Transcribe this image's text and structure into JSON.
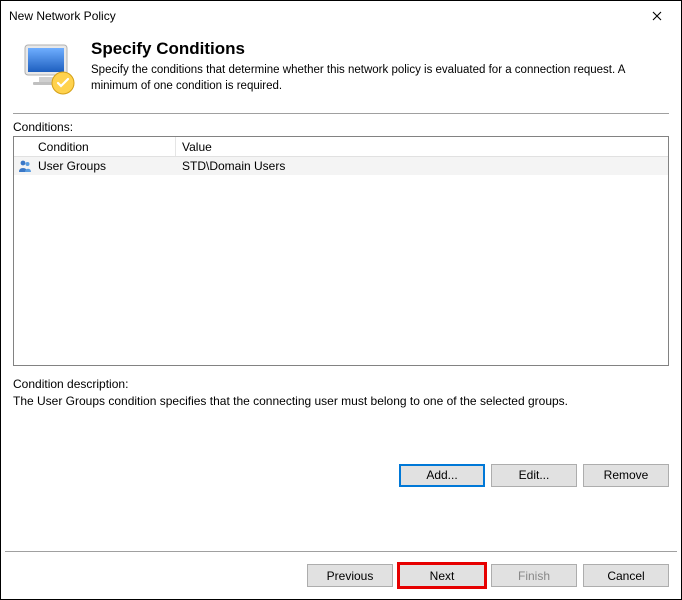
{
  "window": {
    "title": "New Network Policy"
  },
  "header": {
    "heading": "Specify Conditions",
    "subtext": "Specify the conditions that determine whether this network policy is evaluated for a connection request. A minimum of one condition is required."
  },
  "conditionsLabel": "Conditions:",
  "columns": {
    "condition": "Condition",
    "value": "Value"
  },
  "conditions": [
    {
      "name": "User Groups",
      "value": "STD\\Domain Users"
    }
  ],
  "description": {
    "label": "Condition description:",
    "text": "The User Groups condition specifies that the connecting user must belong to one of the selected groups."
  },
  "buttons": {
    "add": "Add...",
    "edit": "Edit...",
    "remove": "Remove",
    "previous": "Previous",
    "next": "Next",
    "finish": "Finish",
    "cancel": "Cancel"
  }
}
